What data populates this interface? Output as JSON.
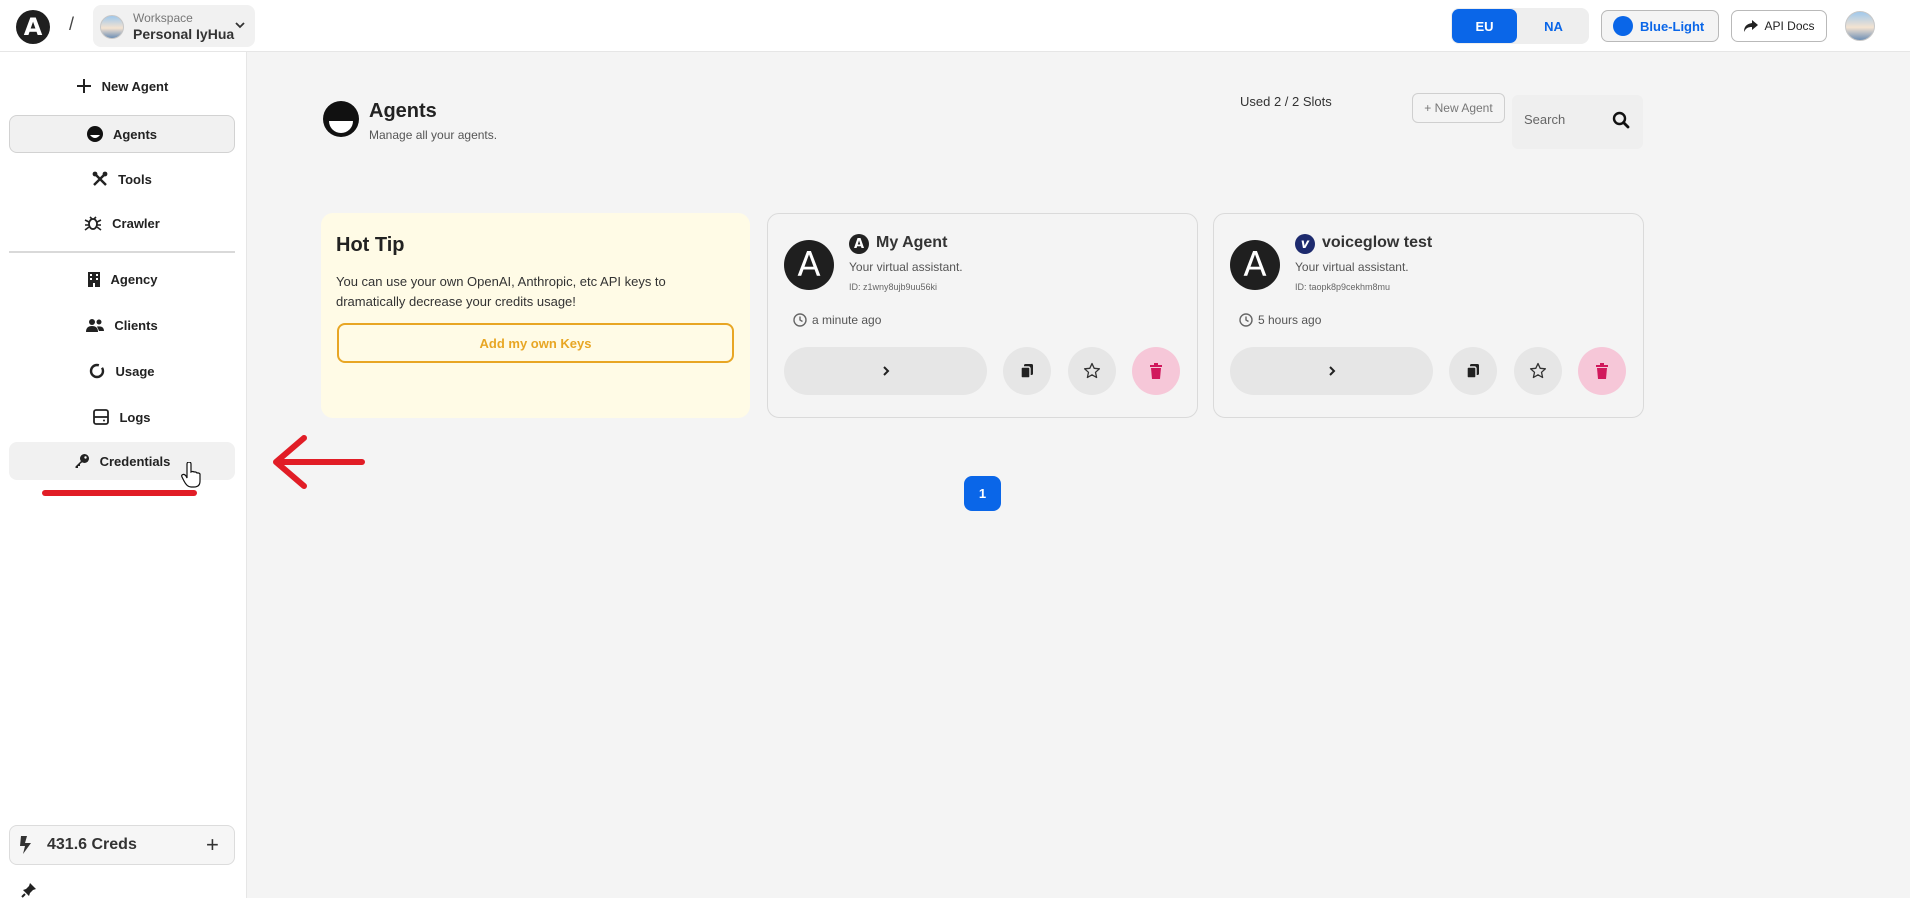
{
  "header": {
    "logo_letter": "A",
    "separator": "/",
    "workspace_label": "Workspace",
    "workspace_name": "Personal IyHua",
    "region": {
      "selected": "EU",
      "options": [
        "EU",
        "NA"
      ]
    },
    "theme_label": "Blue-Light",
    "api_docs_label": "API Docs"
  },
  "sidebar": {
    "new_agent": "New Agent",
    "items": [
      {
        "label": "Agents"
      },
      {
        "label": "Tools"
      },
      {
        "label": "Crawler"
      },
      {
        "label": "Agency"
      },
      {
        "label": "Clients"
      },
      {
        "label": "Usage"
      },
      {
        "label": "Logs"
      },
      {
        "label": "Credentials"
      }
    ],
    "credits": "431.6 Creds",
    "credits_add": "+"
  },
  "main": {
    "title": "Agents",
    "subtitle": "Manage all your agents.",
    "slots": "Used 2 / 2 Slots",
    "new_agent_button": "+ New Agent",
    "search_placeholder": "Search",
    "tip": {
      "title": "Hot Tip",
      "text": "You can use your own OpenAI, Anthropic, etc API keys to dramatically decrease your credits usage!",
      "button": "Add my own Keys"
    },
    "agents": [
      {
        "avatar_letter": "A",
        "mini_letter": "A",
        "name": "My Agent",
        "desc": "Your virtual assistant.",
        "id": "ID: z1wny8ujb9uu56ki",
        "time": "a minute ago",
        "open": ">"
      },
      {
        "avatar_letter": "A",
        "mini_letter": "v",
        "name": "voiceglow test",
        "desc": "Your virtual assistant.",
        "id": "ID: taopk8p9cekhm8mu",
        "time": "5 hours ago",
        "open": ">"
      }
    ],
    "page": "1"
  },
  "colors": {
    "accent": "#0a66e8",
    "tip_bg": "#fffbe6",
    "tip_accent": "#e8a624",
    "delete_bg": "#f6c7d8",
    "delete_icon": "#d1185c",
    "annotation": "#e11d26"
  }
}
